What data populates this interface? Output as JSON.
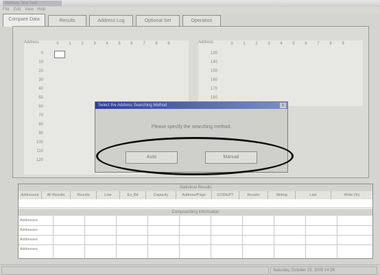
{
  "window": {
    "title": "Memory Test Tool"
  },
  "menu": [
    "File",
    "Edit",
    "View",
    "Help"
  ],
  "tabs": [
    "Compare Data",
    "Results",
    "Address Log",
    "Optional Set",
    "Operation"
  ],
  "grid_left": {
    "header": "Address",
    "columns": [
      "0",
      "1",
      "2",
      "3",
      "4",
      "5",
      "6",
      "7",
      "8",
      "9"
    ],
    "rows": [
      "0",
      "10",
      "20",
      "30",
      "40",
      "50",
      "60",
      "70",
      "80",
      "90",
      "100",
      "110",
      "120"
    ]
  },
  "grid_right": {
    "header": "Address",
    "columns": [
      "0",
      "1",
      "2",
      "3",
      "4",
      "5",
      "6",
      "7",
      "8",
      "9"
    ],
    "rows": [
      "130",
      "140",
      "150",
      "160",
      "170",
      "180"
    ]
  },
  "dialog": {
    "title": "Select the Address Searching Method",
    "close": "x",
    "message": "Please specify the searching method.",
    "buttons": [
      "Auto",
      "Manual"
    ]
  },
  "statistics": {
    "band_title": "Statistical Results",
    "columns": [
      "Addresses",
      "All Results",
      "Results",
      "Line",
      "Ex_Bit",
      "Capacity",
      "Address/Page",
      "CODE/PT",
      "Results",
      "Sliding",
      "Last",
      "Write (%)"
    ],
    "band2_title": "Compounding Information",
    "row_labels": [
      "Addresses",
      "Addresses",
      "Addresses",
      "Addresses"
    ]
  },
  "status": {
    "datetime": "Saturday, October 15, 2005 14:36"
  }
}
